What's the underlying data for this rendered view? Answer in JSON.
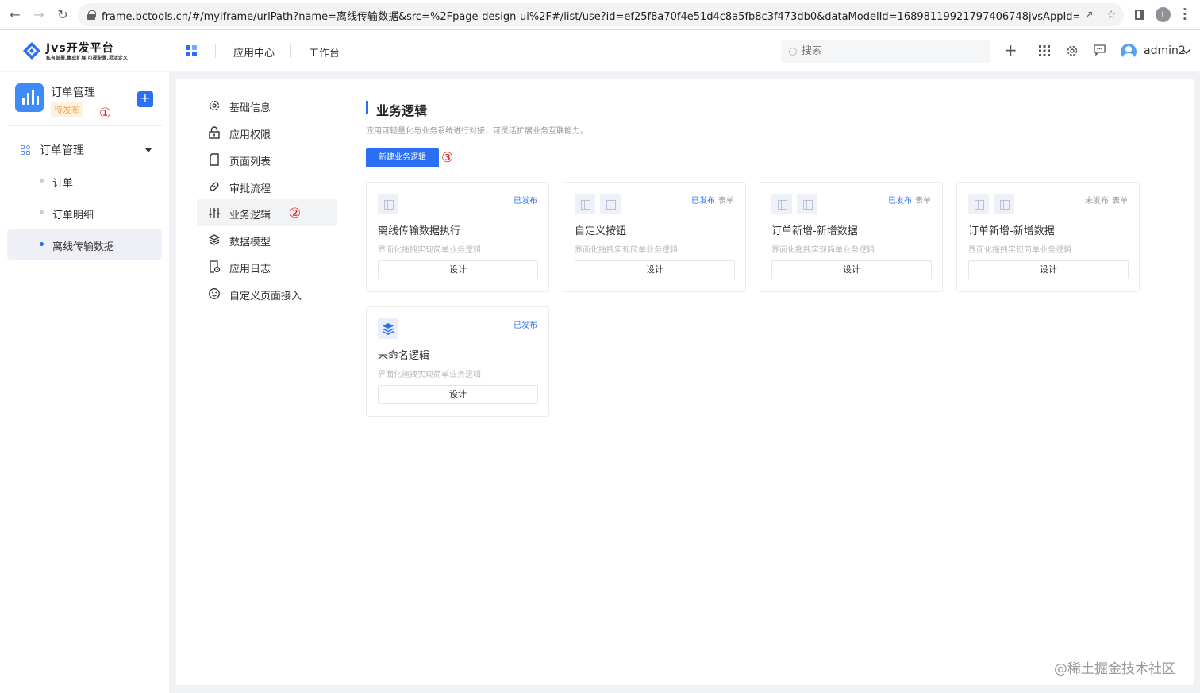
{
  "browser": {
    "url": "frame.bctools.cn/#/myiframe/urlPath?name=离线传输数据&src=%2Fpage-design-ui%2F#/list/use?id=ef25f8a70f4e51d4c8a5fb8c3f473db0&dataModelId=16898119921797406748jvsAppId=e173dfec74342...",
    "profile_initial": "t"
  },
  "header": {
    "brand": "Jvs开发平台",
    "slogan": "私有部署,集成扩展,可视配置,灵活定义",
    "links": [
      "应用中心",
      "工作台"
    ],
    "search_placeholder": "搜索",
    "username": "admin2"
  },
  "sidebar": {
    "app_name": "订单管理",
    "app_status": "待发布",
    "marker_1": "①",
    "group_label": "订单管理",
    "items": [
      {
        "label": "订单"
      },
      {
        "label": "订单明细"
      },
      {
        "label": "离线传输数据"
      }
    ]
  },
  "menu": {
    "items": [
      {
        "label": "基础信息",
        "icon": "gear-icon"
      },
      {
        "label": "应用权限",
        "icon": "lock-icon"
      },
      {
        "label": "页面列表",
        "icon": "page-icon"
      },
      {
        "label": "审批流程",
        "icon": "link-icon"
      },
      {
        "label": "业务逻辑",
        "icon": "sliders-icon"
      },
      {
        "label": "数据模型",
        "icon": "layers-icon"
      },
      {
        "label": "应用日志",
        "icon": "log-icon"
      },
      {
        "label": "自定义页面接入",
        "icon": "smile-icon"
      }
    ],
    "marker_2": "②"
  },
  "content": {
    "title": "业务逻辑",
    "description": "应用可轻量化与业务系统进行对接，可灵活扩展业务互联能力。",
    "new_button": "新建业务逻辑",
    "marker_3": "③",
    "cards": [
      {
        "title": "离线传输数据执行",
        "desc": "界面化拖拽实现简单业务逻辑",
        "status": "已发布",
        "tag": "",
        "button": "设计"
      },
      {
        "title": "自定义按钮",
        "desc": "界面化拖拽实现简单业务逻辑",
        "status": "已发布",
        "tag": "表单",
        "button": "设计"
      },
      {
        "title": "订单新增-新增数据",
        "desc": "界面化拖拽实现简单业务逻辑",
        "status": "已发布",
        "tag": "表单",
        "button": "设计"
      },
      {
        "title": "订单新增-新增数据",
        "desc": "界面化拖拽实现简单业务逻辑",
        "status": "未发布",
        "tag": "表单",
        "button": "设计"
      },
      {
        "title": "未命名逻辑",
        "desc": "界面化拖拽实现简单业务逻辑",
        "status": "已发布",
        "tag": "",
        "button": "设计"
      }
    ]
  },
  "watermark": "@稀土掘金技术社区",
  "colors": {
    "accent": "#2b6ff4",
    "published": "#2b6ff4",
    "pending": "#f5a142",
    "marker": "#e02020"
  }
}
